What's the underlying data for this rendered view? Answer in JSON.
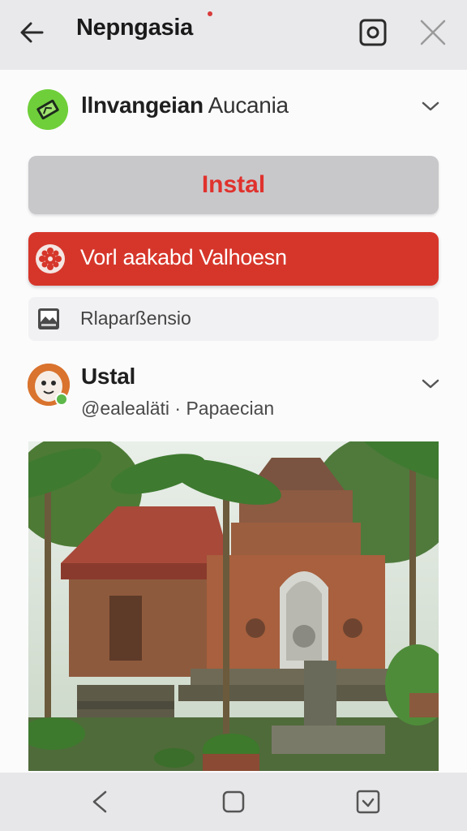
{
  "header": {
    "title": "Nepngasia",
    "back_icon": "arrow-left-icon",
    "camera_icon": "camera-icon",
    "close_icon": "close-icon"
  },
  "app": {
    "name_bold": "llnvangeian",
    "name_rest": " Aucania",
    "icon": "app-logo-icon",
    "icon_color": "#6fcf3a"
  },
  "install_button": {
    "label": "Instal",
    "text_color": "#e0322d"
  },
  "download_button": {
    "label": "Vorl aakabd Valhoesn",
    "icon": "gear-icon",
    "color": "#d6362a"
  },
  "permissions": {
    "label": "Rlaparßensio",
    "icon": "image-icon"
  },
  "developer": {
    "name": "Ustal",
    "handle": "@ealealäti · Papaecian",
    "avatar": "cartoon-avatar"
  },
  "photo": {
    "subject": "balinese-temple-image"
  },
  "nav": {
    "back_icon": "nav-back-icon",
    "home_icon": "nav-home-icon",
    "recent_icon": "nav-recent-icon"
  }
}
